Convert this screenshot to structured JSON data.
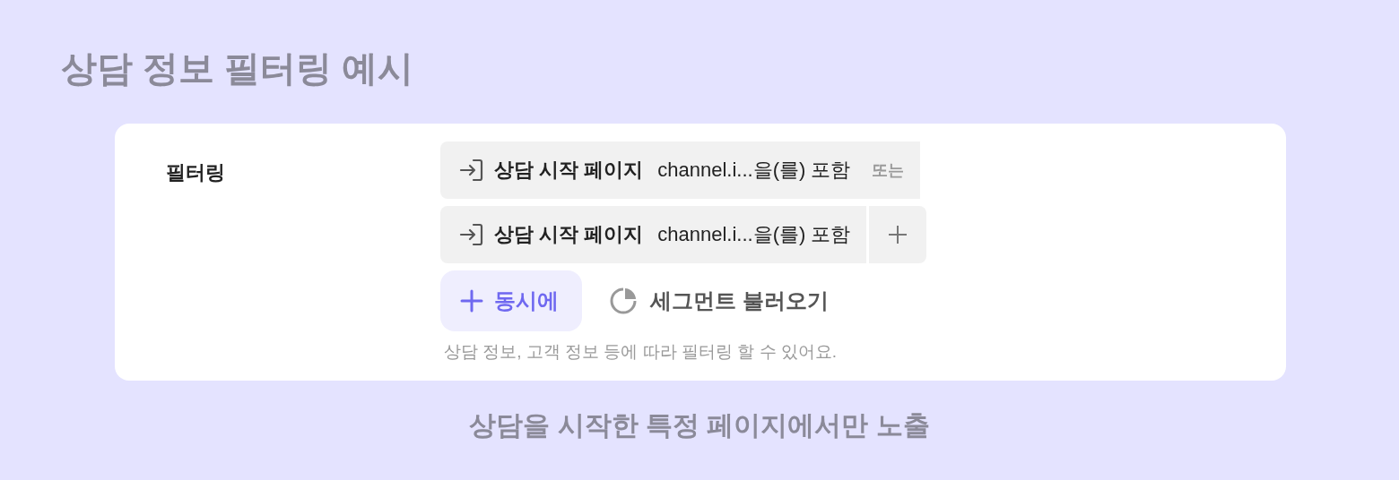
{
  "title": "상담 정보 필터링 예시",
  "panel": {
    "label": "필터링",
    "filters": [
      {
        "field": "상담 시작 페이지",
        "condition": "channel.i...을(를) 포함",
        "kind": "or",
        "trail": "또는"
      },
      {
        "field": "상담 시작 페이지",
        "condition": "channel.i...을(를) 포함",
        "kind": "add"
      }
    ],
    "and_button": "동시에",
    "segment_button": "세그먼트 불러오기",
    "hint": "상담 정보, 고객 정보 등에 따라 필터링 할 수 있어요."
  },
  "caption": "상담을 시작한 특정 페이지에서만 노출"
}
